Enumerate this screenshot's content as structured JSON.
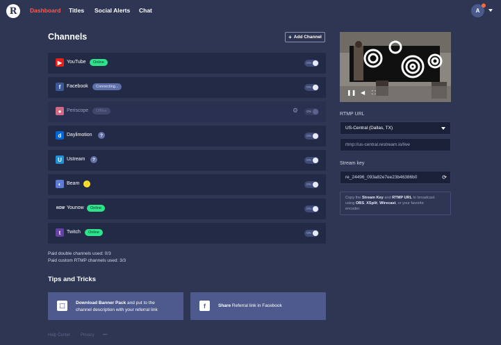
{
  "nav": {
    "logo": "R",
    "links": [
      "Dashboard",
      "Titles",
      "Social Alerts",
      "Chat"
    ],
    "avatar_initial": "A"
  },
  "channels": {
    "title": "Channels",
    "add_label": "Add Channel",
    "toggle_label": "ON",
    "items": [
      {
        "name": "YouTube",
        "badge": "Online",
        "icon": "youtube-icon",
        "color": "#e62117",
        "glyph": "▶"
      },
      {
        "name": "Facebook",
        "badge": "Connecting...",
        "icon": "facebook-icon",
        "color": "#3b5998",
        "glyph": "f"
      },
      {
        "name": "Periscope",
        "badge": "Offline",
        "icon": "periscope-icon",
        "color": "#d06a84",
        "glyph": "●"
      },
      {
        "name": "Daylimotion",
        "icon": "dailymotion-icon",
        "color": "#0066dc",
        "glyph": "d"
      },
      {
        "name": "Ustream",
        "icon": "ustream-icon",
        "color": "#1f8fd6",
        "glyph": "U"
      },
      {
        "name": "Beam",
        "icon": "beam-icon",
        "color": "#5b7bd6",
        "glyph": "◐"
      },
      {
        "name": "Younow",
        "badge": "Online",
        "icon": "younow-icon",
        "color": "#232a45",
        "glyph": "NOW"
      },
      {
        "name": "Twitch",
        "badge": "Online",
        "icon": "twitch-icon",
        "color": "#6441a5",
        "glyph": "t"
      }
    ]
  },
  "paid": {
    "double": "Paid double channels used: 0/3",
    "custom": "Paid custom RTMP channels used: 3/3"
  },
  "tips": {
    "title": "Tips and Tricks",
    "banner_bold": "Download Banner Pack",
    "banner_rest": " and put to the",
    "banner_line2": "channel description with your referral link",
    "share_bold": "Share",
    "share_rest": " Referral link in Facebook"
  },
  "footer": {
    "help": "Help Center",
    "privacy": "Privacy",
    "more": "•••"
  },
  "stream": {
    "rtmp_label": "RTMP URL",
    "server": "US-Central (Dallas, TX)",
    "rtmp_url": "rtmp://us-central.restream.io/live",
    "key_label": "Stream key",
    "key": "re_24496_093a82e7ee23b46386b0",
    "info_1": "Copy the ",
    "info_stream_key": "Stream Key",
    "info_2": " and ",
    "info_rtmp": "RTMP URL",
    "info_3": " to broadcast",
    "info_4": "using ",
    "info_obs": "OBS",
    "info_sep1": ", ",
    "info_xsplit": "XSplit",
    "info_sep2": ", ",
    "info_wirecast": "Wirecast",
    "info_5": ", or your favorite",
    "info_6": "encoder."
  },
  "colors": {
    "background": "#2e3654",
    "accent": "#ff5a4a",
    "online": "#2de38b",
    "card": "#4e5a8e"
  }
}
